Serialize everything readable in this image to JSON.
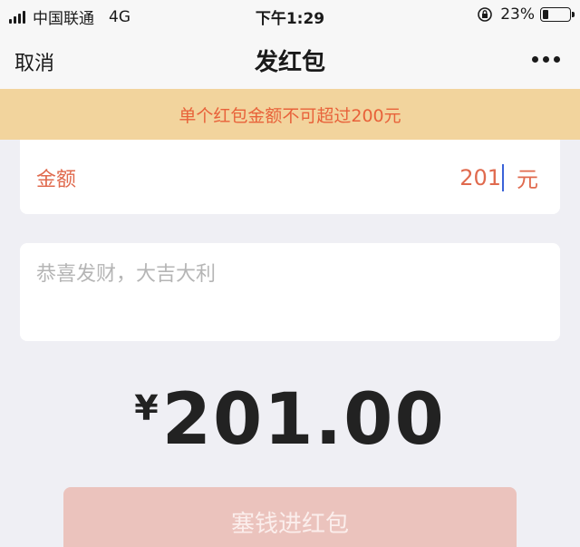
{
  "status_bar": {
    "carrier": "中国联通",
    "network": "4G",
    "time": "下午1:29",
    "battery_percent": "23%",
    "battery_level": 0.23
  },
  "nav": {
    "cancel_label": "取消",
    "title": "发红包"
  },
  "warning": {
    "text": "单个红包金额不可超过200元"
  },
  "amount": {
    "label": "金额",
    "value": "201",
    "unit": "元"
  },
  "greeting": {
    "placeholder": "恭喜发财，大吉大利"
  },
  "total": {
    "currency": "¥",
    "amount": "201.00"
  },
  "submit": {
    "label": "塞钱进红包"
  },
  "colors": {
    "accent": "#e06a4e",
    "warning_bg": "#f2d49d",
    "button_disabled": "#ebc3bd",
    "caret": "#3a62d8"
  }
}
